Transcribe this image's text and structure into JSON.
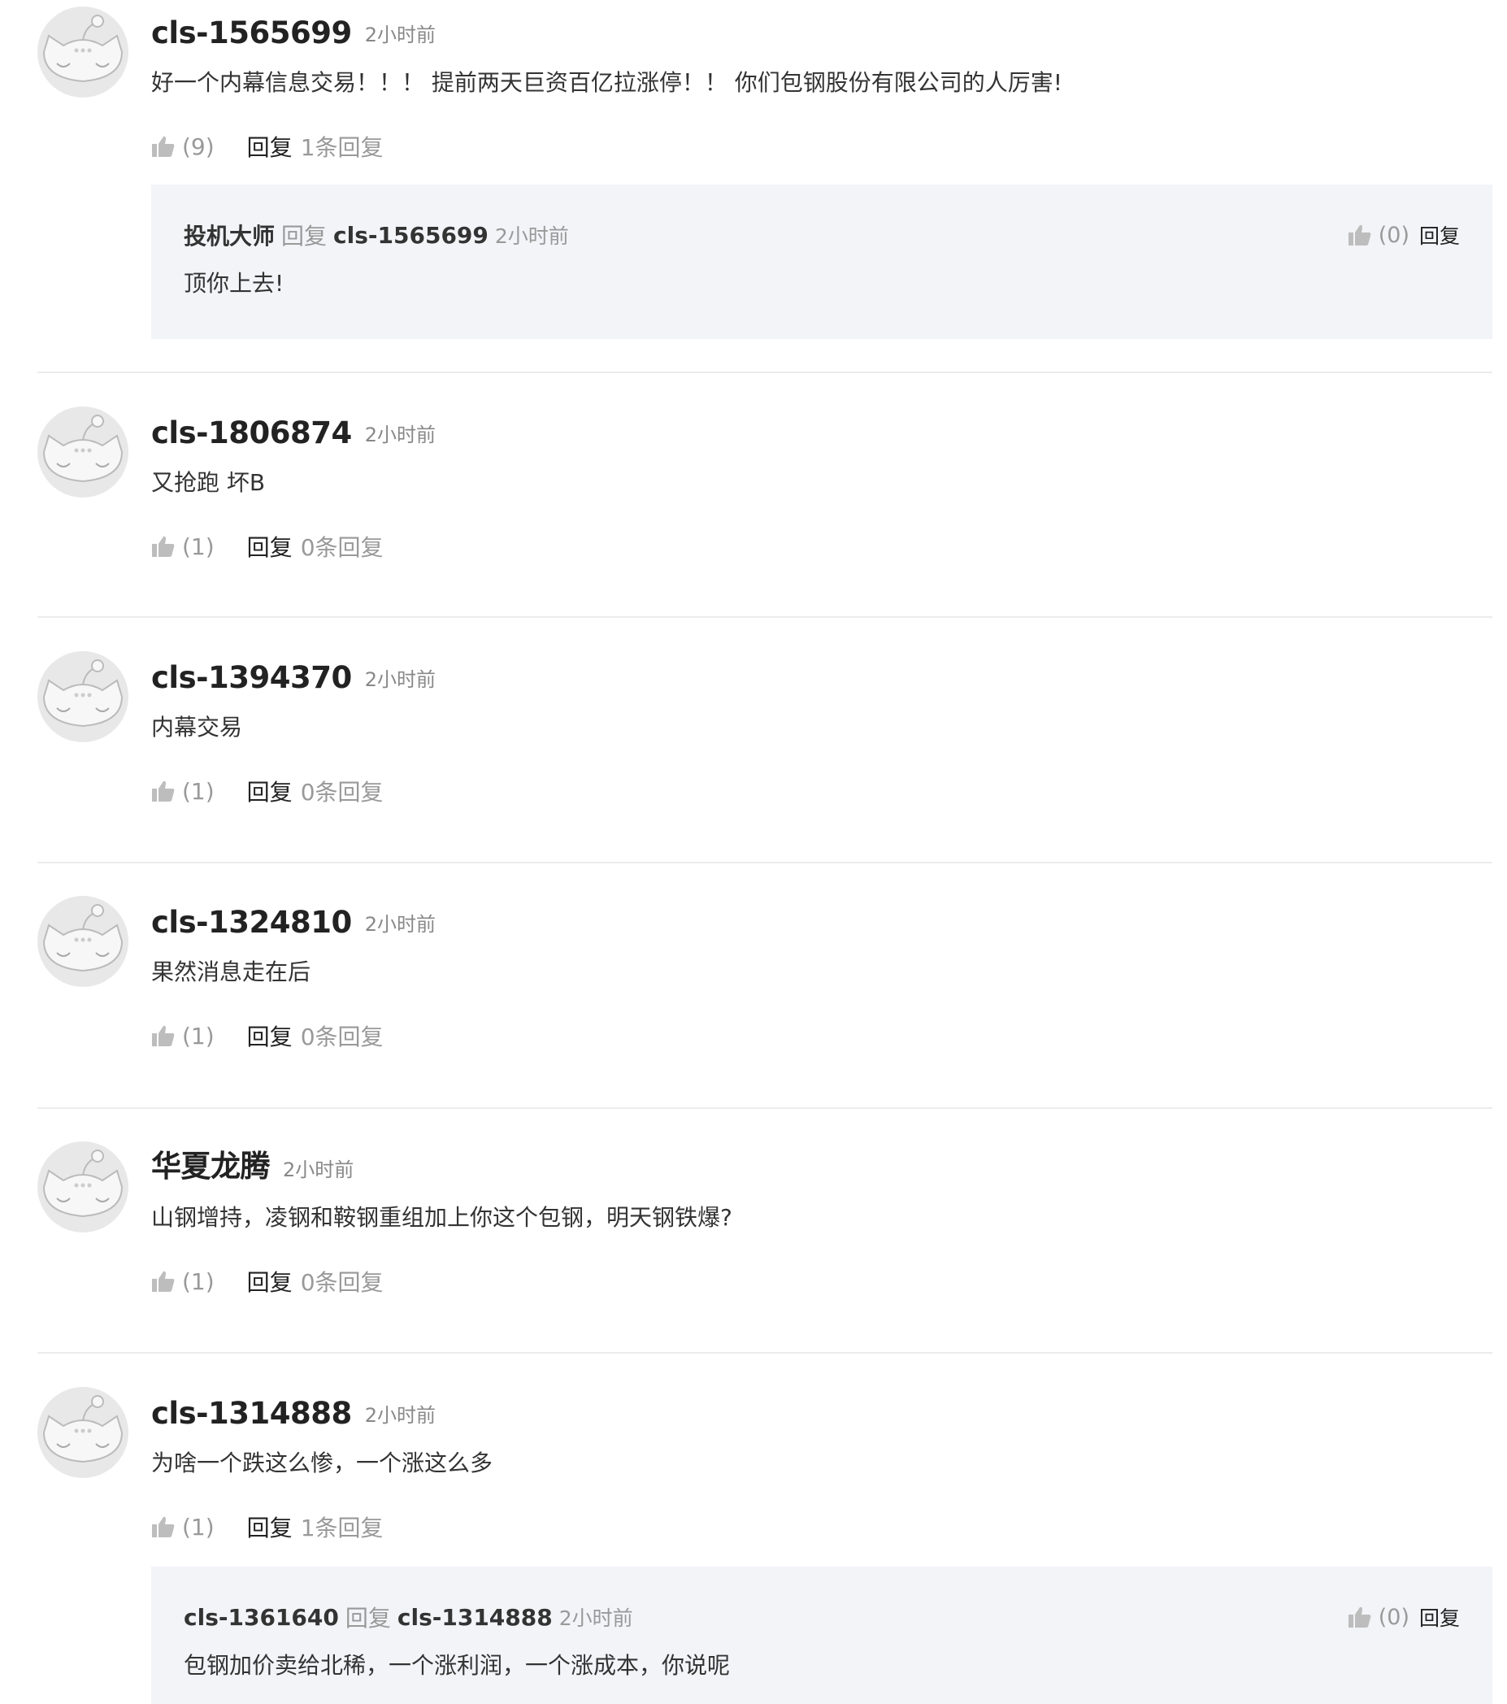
{
  "reply_label": "回复",
  "comments": [
    {
      "user": "cls-1565699",
      "time": "2小时前",
      "text": "好一个内幕信息交易！！！ 提前两天巨资百亿拉涨停！！ 你们包钢股份有限公司的人厉害!",
      "likes": "(9)",
      "reply_count": "1条回复",
      "replies": [
        {
          "user": "投机大师",
          "mid": "回复",
          "to": "cls-1565699",
          "time": "2小时前",
          "text": "顶你上去!",
          "likes": "(0)"
        }
      ]
    },
    {
      "user": "cls-1806874",
      "time": "2小时前",
      "text": "又抢跑 坏B",
      "likes": "(1)",
      "reply_count": "0条回复"
    },
    {
      "user": "cls-1394370",
      "time": "2小时前",
      "text": "内幕交易",
      "likes": "(1)",
      "reply_count": "0条回复"
    },
    {
      "user": "cls-1324810",
      "time": "2小时前",
      "text": "果然消息走在后",
      "likes": "(1)",
      "reply_count": "0条回复"
    },
    {
      "user": "华夏龙腾",
      "time": "2小时前",
      "text": "山钢增持，凌钢和鞍钢重组加上你这个包钢，明天钢铁爆?",
      "likes": "(1)",
      "reply_count": "0条回复"
    },
    {
      "user": "cls-1314888",
      "time": "2小时前",
      "text": "为啥一个跌这么惨，一个涨这么多",
      "likes": "(1)",
      "reply_count": "1条回复",
      "replies": [
        {
          "user": "cls-1361640",
          "mid": "回复",
          "to": "cls-1314888",
          "time": "2小时前",
          "text": "包钢加价卖给北稀，一个涨利润，一个涨成本，你说呢",
          "likes": "(0)"
        }
      ]
    }
  ]
}
